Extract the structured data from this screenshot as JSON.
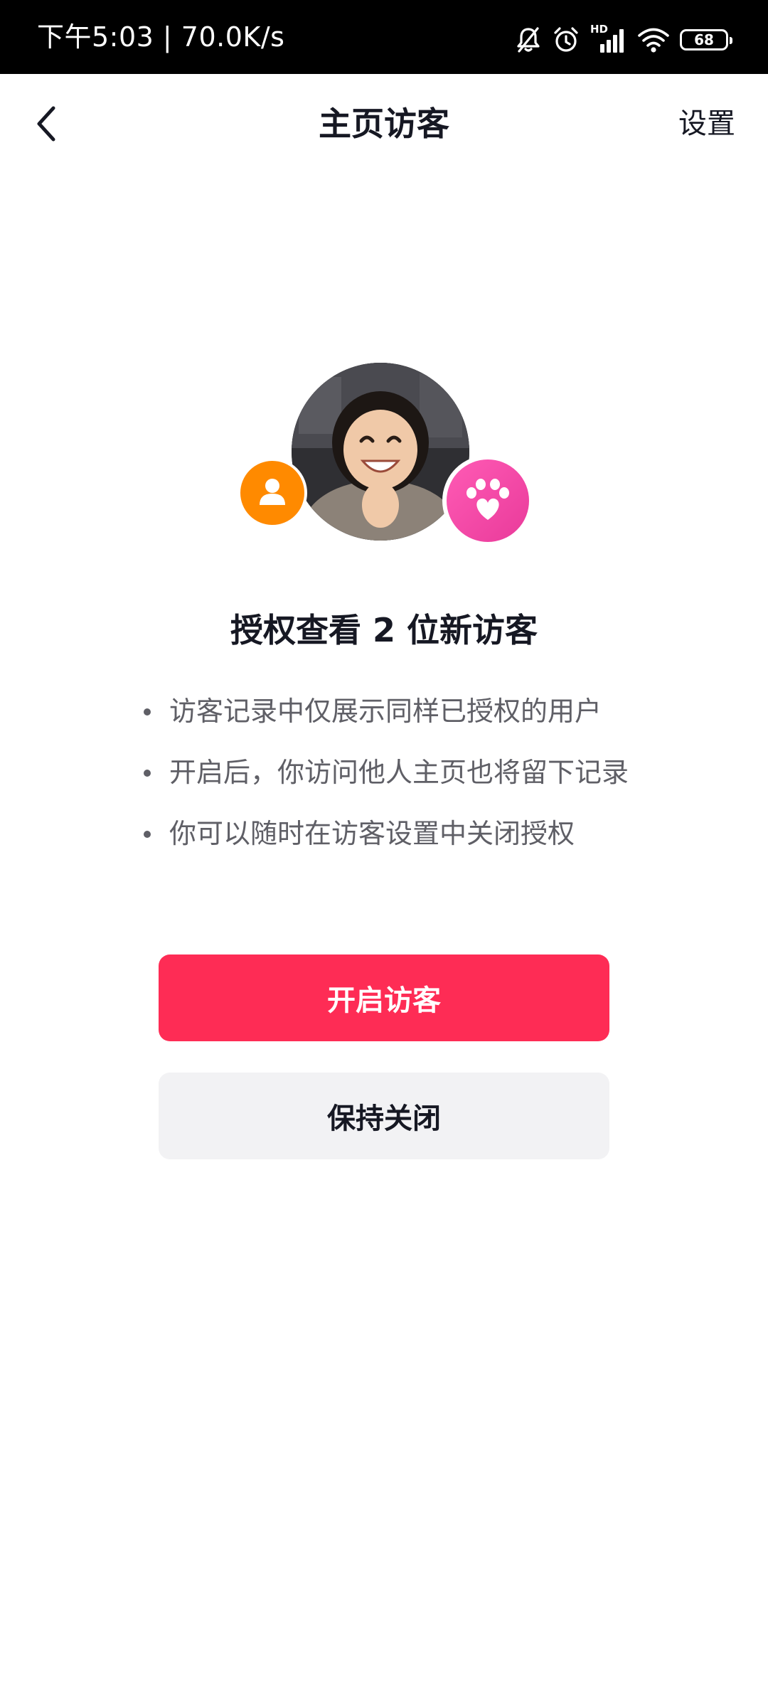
{
  "status_bar": {
    "time_speed": "下午5:03 | 70.0K/s",
    "network_label": "HD",
    "battery": "68",
    "icons": [
      "mute-bell-icon",
      "alarm-icon",
      "signal-icon",
      "wifi-icon",
      "battery-icon"
    ]
  },
  "nav": {
    "back_icon": "chevron-left-icon",
    "title": "主页访客",
    "settings": "设置"
  },
  "avatars": {
    "left_badge_icon": "user-icon",
    "left_badge_color": "#ff8a00",
    "main_avatar": "user-photo-avatar",
    "right_badge_icon": "paw-heart-icon",
    "right_badge_color": "#f04aa8"
  },
  "main": {
    "headline": "授权查看 2 位新访客",
    "bullets": [
      "访客记录中仅展示同样已授权的用户",
      "开启后，你访问他人主页也将留下记录",
      "你可以随时在访客设置中关闭授权"
    ]
  },
  "actions": {
    "enable_label": "开启访客",
    "keep_off_label": "保持关闭",
    "primary_color": "#fe2c55",
    "secondary_color": "#f2f2f4"
  }
}
